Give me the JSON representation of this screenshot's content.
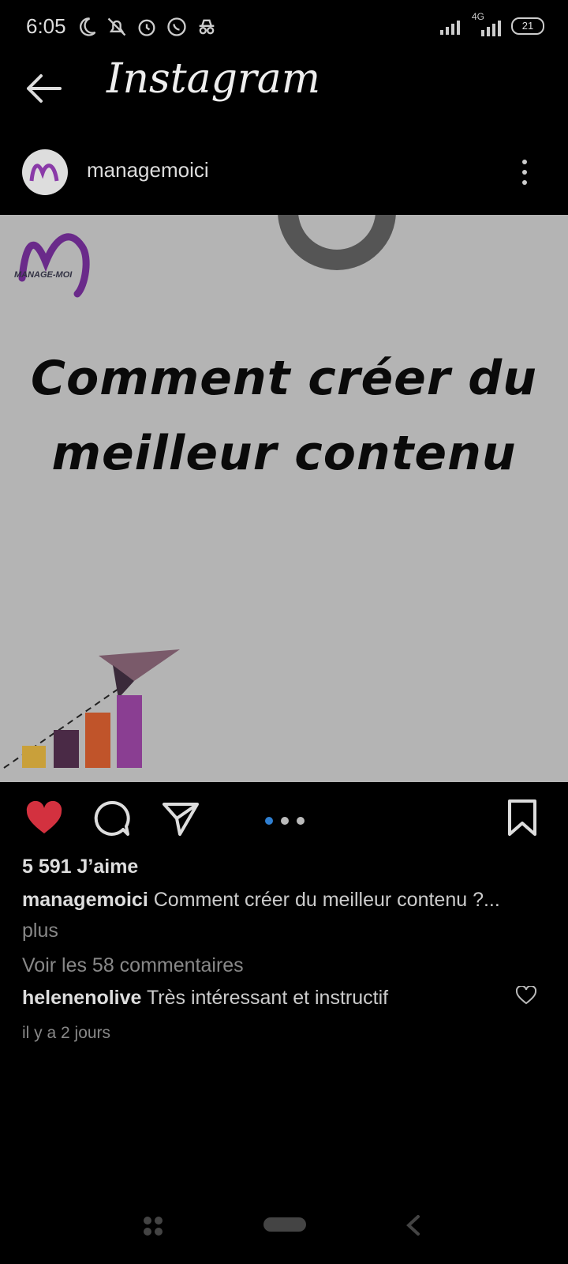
{
  "status_bar": {
    "time": "6:05",
    "network": "4G",
    "battery": "21"
  },
  "header": {
    "title": "Instagram"
  },
  "post": {
    "username": "managemoici",
    "logo_text": "MANAGE-MOI",
    "image_title": "Comment créer du meilleur contenu",
    "carousel_total": 3,
    "carousel_active": 1,
    "likes": "5 591 J’aime",
    "caption_user": "managemoici",
    "caption_text": "Comment créer du meilleur contenu ?...",
    "caption_more": "plus",
    "view_comments": "Voir les 58 commentaires",
    "comment_user": "helenenolive",
    "comment_text": "Très intéressant et instructif",
    "time_ago": "il y a 2 jours",
    "liked": true
  }
}
